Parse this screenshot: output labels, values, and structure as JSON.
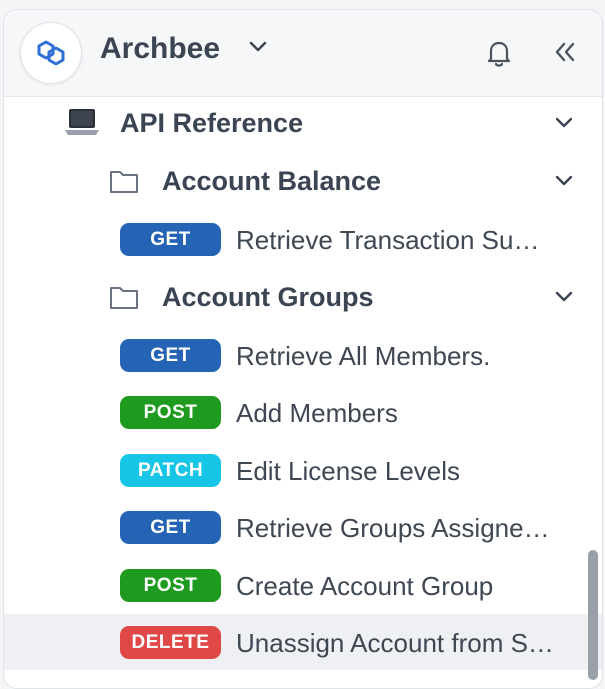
{
  "header": {
    "brand": "Archbee",
    "logo_icon": "archbee-logo-icon",
    "dropdown_icon": "chevron-down-icon",
    "notifications_icon": "bell-icon",
    "collapse_icon": "double-chevron-left-icon"
  },
  "colors": {
    "GET": "#2563b4",
    "POST": "#1e9a1e",
    "PATCH": "#17c6e6",
    "DELETE": "#e04747"
  },
  "tree": {
    "root": {
      "label": "API Reference",
      "icon": "laptop-icon"
    },
    "groups": [
      {
        "label": "Account Balance",
        "icon": "folder-icon",
        "items": [
          {
            "method": "GET",
            "label": "Retrieve Transaction Su…"
          }
        ]
      },
      {
        "label": "Account Groups",
        "icon": "folder-icon",
        "items": [
          {
            "method": "GET",
            "label": "Retrieve All Members."
          },
          {
            "method": "POST",
            "label": "Add Members"
          },
          {
            "method": "PATCH",
            "label": "Edit License Levels"
          },
          {
            "method": "GET",
            "label": "Retrieve Groups Assigne…"
          },
          {
            "method": "POST",
            "label": "Create Account Group"
          },
          {
            "method": "DELETE",
            "label": "Unassign Account from S…"
          }
        ]
      }
    ]
  }
}
